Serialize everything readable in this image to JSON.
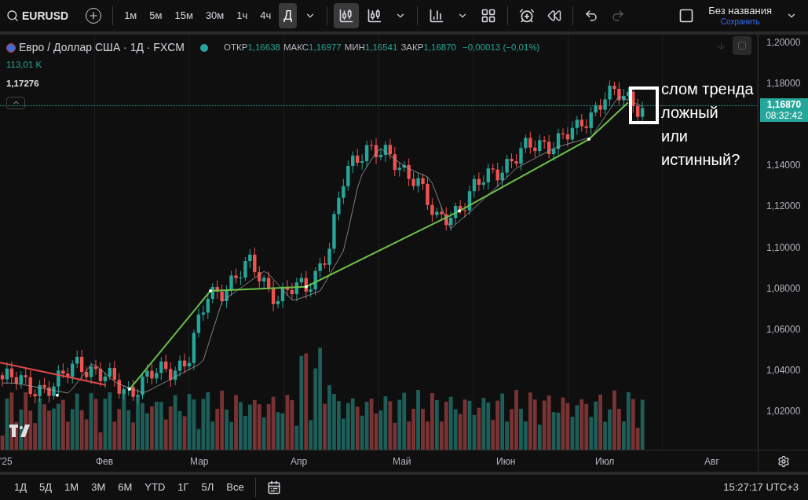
{
  "toolbar": {
    "symbol": "EURUSD",
    "intervals": [
      {
        "label": "1м",
        "selected": false
      },
      {
        "label": "5м",
        "selected": false
      },
      {
        "label": "15м",
        "selected": false
      },
      {
        "label": "30м",
        "selected": false
      },
      {
        "label": "1ч",
        "selected": false
      },
      {
        "label": "4ч",
        "selected": false
      },
      {
        "label": "Д",
        "selected": true
      }
    ],
    "layout_title": "Без названия",
    "save_link": "Сохранить"
  },
  "legend": {
    "title": "Евро / Доллар США · 1Д · FXCM",
    "ohlc": [
      {
        "label": "ОТКР",
        "value": "1,16638"
      },
      {
        "label": "МАКС",
        "value": "1,16977"
      },
      {
        "label": "МИН",
        "value": "1,16541"
      },
      {
        "label": "ЗАКР",
        "value": "1,16870"
      }
    ],
    "change": "−0,00013 (−0,01%)",
    "volume": "113,01 K",
    "indicator_value": "1,17276"
  },
  "price_axis": {
    "ticks": [
      "1,20000",
      "1,18000",
      "1,14000",
      "1,12000",
      "1,10000",
      "1,08000",
      "1,06000",
      "1,04000",
      "1,02000"
    ],
    "last_price": "1,16870",
    "countdown": "08:32:42"
  },
  "annotation": {
    "text": "слом тренда\nложный\nили\nистинный?"
  },
  "time_axis": {
    "labels": [
      "'25",
      "Фев",
      "Мар",
      "Апр",
      "Май",
      "Июн",
      "Июл",
      "Авг"
    ]
  },
  "bottom_bar": {
    "ranges": [
      "1Д",
      "5Д",
      "1М",
      "3М",
      "6М",
      "YTD",
      "1Г",
      "5Л",
      "Все"
    ],
    "clock": "15:27:17 UTC+3"
  }
}
